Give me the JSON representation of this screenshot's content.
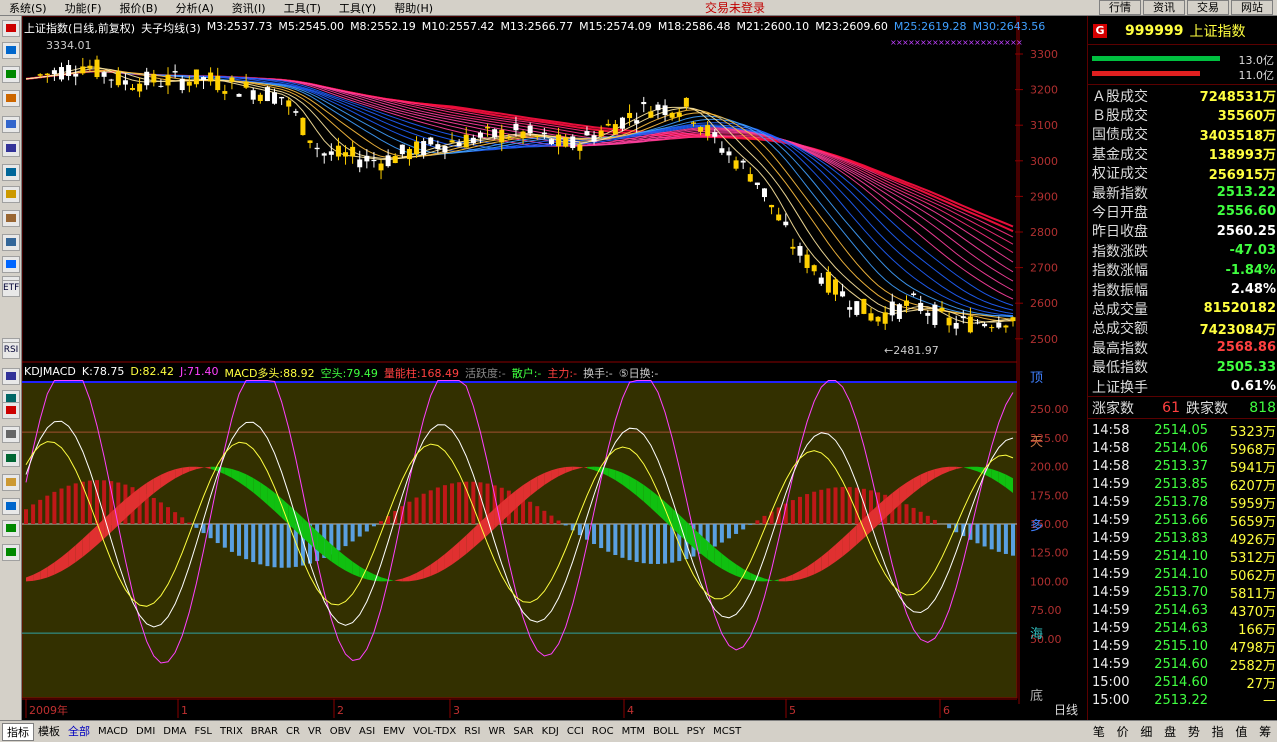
{
  "menu": {
    "items": [
      "系统(S)",
      "功能(F)",
      "报价(B)",
      "分析(A)",
      "资讯(I)",
      "工具(T)",
      "工具(Y)",
      "帮助(H)"
    ],
    "status": "交易未登录",
    "right_buttons": [
      "行情",
      "资讯",
      "交易",
      "网站"
    ]
  },
  "toolbar": [
    "",
    "",
    "",
    "",
    "",
    "",
    "",
    "",
    "",
    "",
    "",
    "",
    "ETF",
    "",
    "",
    "RSI",
    "",
    "",
    "",
    "",
    "",
    "",
    "",
    "",
    "",
    ""
  ],
  "main_chart": {
    "title": "上证指数(日线,前复权)",
    "indicator_name": "夫子均线(3)",
    "mas": [
      {
        "label": "M3:2537.73",
        "color": "#ffffff"
      },
      {
        "label": "M5:2545.00",
        "color": "#ffffff"
      },
      {
        "label": "M8:2552.19",
        "color": "#ffffff"
      },
      {
        "label": "M10:2557.42",
        "color": "#ffffff"
      },
      {
        "label": "M13:2566.77",
        "color": "#ffffff"
      },
      {
        "label": "M15:2574.09",
        "color": "#ffffff"
      },
      {
        "label": "M18:2586.48",
        "color": "#ffffff"
      },
      {
        "label": "M21:2600.10",
        "color": "#ffffff"
      },
      {
        "label": "M23:2609.60",
        "color": "#ffffff"
      },
      {
        "label": "M25:2619.28",
        "color": "#40a0ff"
      },
      {
        "label": "M30:2643.56",
        "color": "#40a0ff"
      }
    ],
    "y_ticks": [
      "3300",
      "3200",
      "3100",
      "3000",
      "2900",
      "2800",
      "2700",
      "2600",
      "2500"
    ],
    "high_label": "3334.01",
    "low_label": "←2481.97",
    "colors": {
      "up": "#ffd000",
      "down": "#ffffff"
    }
  },
  "sub_chart": {
    "name": "KDJMACD",
    "k_label": "K:78.75",
    "d_label": "D:82.42",
    "j_label": "J:71.40",
    "long_label": "MACD多头:88.92",
    "short_label": "空头:79.49",
    "energy_label": "量能柱:168.49",
    "activity_label": "活跃度:-",
    "retail_label": "散户:-",
    "main_force_label": "主力:-",
    "turnover_label": "换手:-",
    "day_turnover_label": "⑤日换:-",
    "y_ticks": [
      "250.00",
      "225.00",
      "200.00",
      "175.00",
      "150.00",
      "125.00",
      "100.00",
      "75.00",
      "50.00"
    ],
    "side_labels": [
      "顶",
      "天",
      "多",
      "海",
      "底"
    ]
  },
  "x_axis": {
    "labels": [
      "2009年",
      "1",
      "2",
      "3",
      "4",
      "5",
      "6"
    ],
    "period": "日线"
  },
  "quote": {
    "badge": "G",
    "code": "999999",
    "name": "上证指数",
    "red_volume": "13.0亿",
    "green_volume": "11.0亿",
    "stats": [
      {
        "label": "Ａ股成交",
        "value": "7248531万",
        "color": "#ffff40"
      },
      {
        "label": "Ｂ股成交",
        "value": "35560万",
        "color": "#ffff40"
      },
      {
        "label": "国债成交",
        "value": "3403518万",
        "color": "#ffff40"
      },
      {
        "label": "基金成交",
        "value": "138993万",
        "color": "#ffff40"
      },
      {
        "label": "权证成交",
        "value": "256915万",
        "color": "#ffff40"
      },
      {
        "label": "最新指数",
        "value": "2513.22",
        "color": "#40ff40"
      },
      {
        "label": "今日开盘",
        "value": "2556.60",
        "color": "#40ff40"
      },
      {
        "label": "昨日收盘",
        "value": "2560.25",
        "color": "#ffffff"
      },
      {
        "label": "指数涨跌",
        "value": "-47.03",
        "color": "#40ff40"
      },
      {
        "label": "指数涨幅",
        "value": "-1.84%",
        "color": "#40ff40"
      },
      {
        "label": "指数振幅",
        "value": "2.48%",
        "color": "#ffffff"
      },
      {
        "label": "总成交量",
        "value": "81520182",
        "color": "#ffff40"
      },
      {
        "label": "总成交额",
        "value": "7423084万",
        "color": "#ffff40"
      },
      {
        "label": "最高指数",
        "value": "2568.86",
        "color": "#ff4040"
      },
      {
        "label": "最低指数",
        "value": "2505.33",
        "color": "#40ff40"
      },
      {
        "label": "上证换手",
        "value": "0.61%",
        "color": "#ffffff"
      }
    ],
    "up_label": "涨家数",
    "up_count": "61",
    "down_label": "跌家数",
    "down_count": "818",
    "ticks": [
      {
        "time": "14:58",
        "price": "2514.05",
        "vol": "5323万"
      },
      {
        "time": "14:58",
        "price": "2514.06",
        "vol": "5968万"
      },
      {
        "time": "14:58",
        "price": "2513.37",
        "vol": "5941万"
      },
      {
        "time": "14:59",
        "price": "2513.85",
        "vol": "6207万"
      },
      {
        "time": "14:59",
        "price": "2513.78",
        "vol": "5959万"
      },
      {
        "time": "14:59",
        "price": "2513.66",
        "vol": "5659万"
      },
      {
        "time": "14:59",
        "price": "2513.83",
        "vol": "4926万"
      },
      {
        "time": "14:59",
        "price": "2514.10",
        "vol": "5312万"
      },
      {
        "time": "14:59",
        "price": "2514.10",
        "vol": "5062万"
      },
      {
        "time": "14:59",
        "price": "2513.70",
        "vol": "5811万"
      },
      {
        "time": "14:59",
        "price": "2514.63",
        "vol": "4370万"
      },
      {
        "time": "14:59",
        "price": "2514.63",
        "vol": "166万"
      },
      {
        "time": "14:59",
        "price": "2515.10",
        "vol": "4798万"
      },
      {
        "time": "14:59",
        "price": "2514.60",
        "vol": "2582万"
      },
      {
        "time": "15:00",
        "price": "2514.60",
        "vol": "27万"
      },
      {
        "time": "15:00",
        "price": "2513.22",
        "vol": "—"
      }
    ]
  },
  "bottom_tabs": [
    "指标",
    "模板",
    "全部",
    "MACD",
    "DMI",
    "DMA",
    "FSL",
    "TRIX",
    "BRAR",
    "CR",
    "VR",
    "OBV",
    "ASI",
    "EMV",
    "VOL-TDX",
    "RSI",
    "WR",
    "SAR",
    "KDJ",
    "CCI",
    "ROC",
    "MTM",
    "BOLL",
    "PSY",
    "MCST"
  ],
  "right_tabs": [
    "笔",
    "价",
    "细",
    "盘",
    "势",
    "指",
    "值",
    "筹"
  ]
}
